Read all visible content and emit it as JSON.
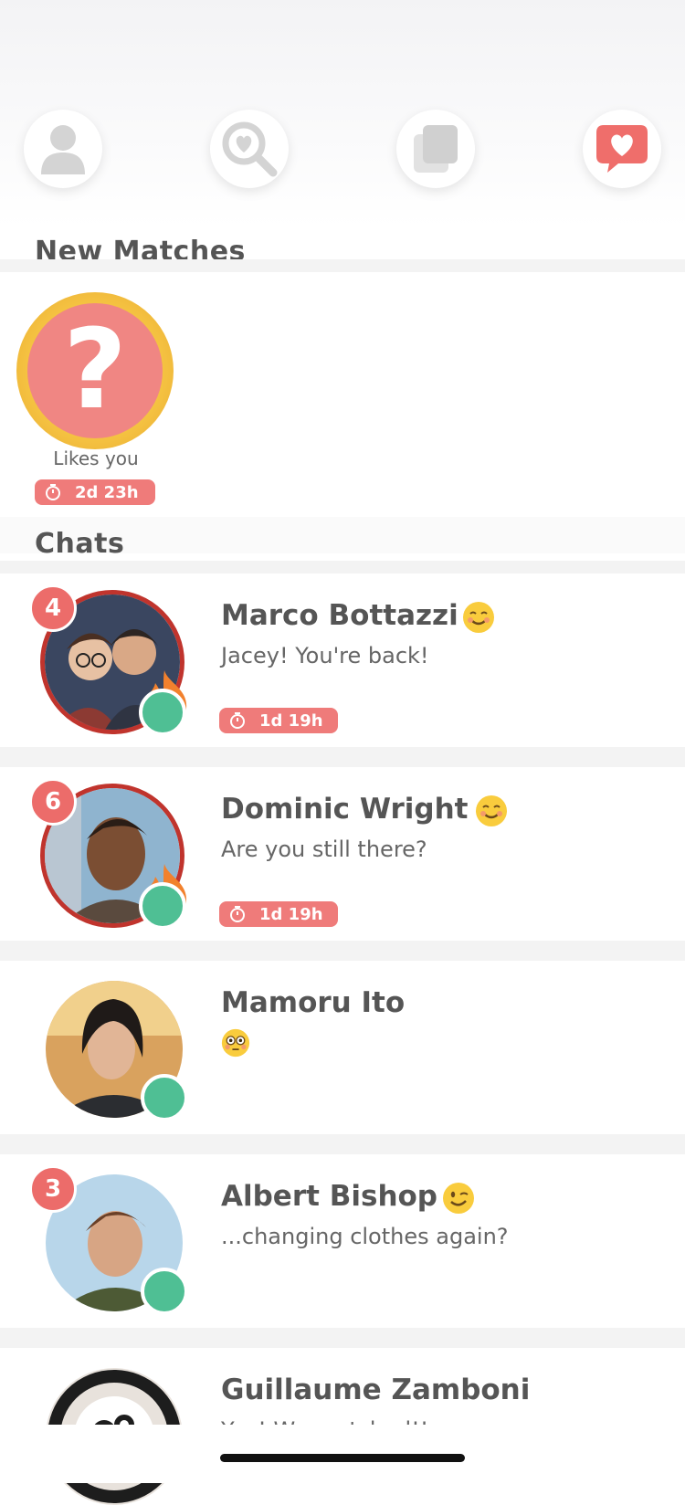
{
  "nav": {
    "icons": [
      "profile-icon",
      "search-heart-icon",
      "cards-icon",
      "chat-heart-icon"
    ],
    "accent": "#ef6e6b"
  },
  "new_matches": {
    "title": "New Matches",
    "items": [
      {
        "label": "Likes you",
        "timer": "2d 23h",
        "glyph": "?"
      }
    ]
  },
  "chats": {
    "title": "Chats",
    "items": [
      {
        "name": "Marco Bottazzi",
        "message": "Jacey! You're back!",
        "unread": "4",
        "timer": "1d 19h",
        "emoji": "smiling-face-icon"
      },
      {
        "name": "Dominic Wright",
        "message": "Are you still there?",
        "unread": "6",
        "timer": "1d 19h",
        "emoji": "smiling-face-icon"
      },
      {
        "name": "Mamoru Ito",
        "message": "",
        "unread": "",
        "timer": "",
        "emoji": "flushed-face-icon"
      },
      {
        "name": "Albert Bishop",
        "message": "...changing clothes again?",
        "unread": "3",
        "timer": "",
        "emoji": "winking-face-icon"
      },
      {
        "name": "Guillaume Zamboni",
        "message": "Yay! We matched!!",
        "unread": "",
        "timer": "",
        "emoji": ""
      }
    ]
  },
  "colors": {
    "timer": "#ef7b7a",
    "online": "#4fbf94",
    "badge": "#ec6c6a",
    "ring": "#c0342d",
    "gold": "#f5c342"
  }
}
